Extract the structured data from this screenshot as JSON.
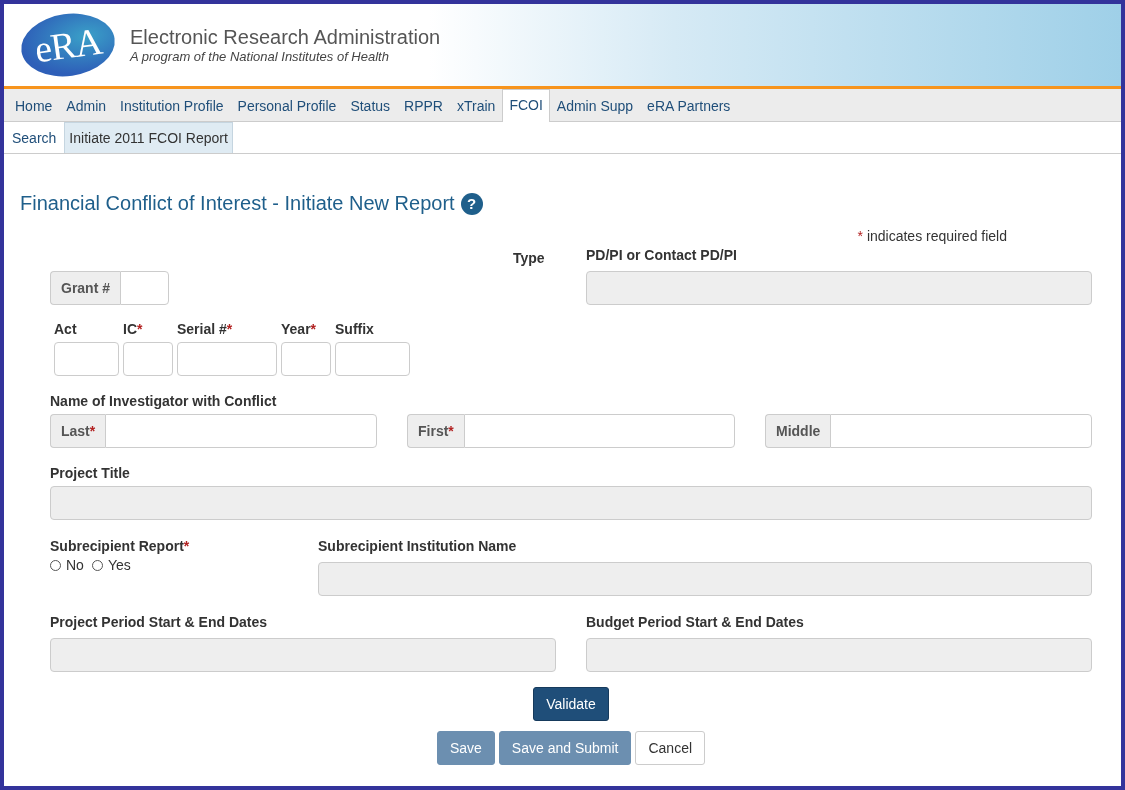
{
  "header": {
    "logo": "eRA",
    "title": "Electronic Research Administration",
    "subtitle": "A program of the National Institutes of Health"
  },
  "nav_tabs": [
    {
      "label": "Home",
      "selected": false
    },
    {
      "label": "Admin",
      "selected": false
    },
    {
      "label": "Institution Profile",
      "selected": false
    },
    {
      "label": "Personal Profile",
      "selected": false
    },
    {
      "label": "Status",
      "selected": false
    },
    {
      "label": "RPPR",
      "selected": false
    },
    {
      "label": "xTrain",
      "selected": false
    },
    {
      "label": "FCOI",
      "selected": true
    },
    {
      "label": "Admin Supp",
      "selected": false
    },
    {
      "label": "eRA Partners",
      "selected": false
    }
  ],
  "sub_tabs": [
    {
      "label": "Search",
      "selected": false
    },
    {
      "label": "Initiate 2011 FCOI Report",
      "selected": true
    }
  ],
  "page_title": "Financial Conflict of Interest - Initiate New Report",
  "help_icon": "?",
  "required_note": {
    "mark": "*",
    "text": "indicates required field"
  },
  "grant": {
    "label": "Grant #",
    "disabled": false
  },
  "type_label": "Type",
  "pd_pi": {
    "label": "PD/PI or Contact PD/PI",
    "disabled": true
  },
  "grant_parts": [
    {
      "label": "Act",
      "disabled": false
    },
    {
      "label": "IC",
      "required_mark": "*",
      "disabled": false
    },
    {
      "label": "Serial #",
      "required_mark": "*",
      "disabled": false
    },
    {
      "label": "Year",
      "required_mark": "*",
      "disabled": false
    },
    {
      "label": "Suffix",
      "disabled": false
    }
  ],
  "investigator": {
    "heading": "Name of Investigator with Conflict",
    "fields": [
      {
        "label": "Last",
        "required_mark": "*",
        "disabled": false
      },
      {
        "label": "First",
        "required_mark": "*",
        "disabled": false
      },
      {
        "label": "Middle",
        "disabled": false
      }
    ]
  },
  "project_title": {
    "label": "Project Title",
    "disabled": true
  },
  "subrecipient": {
    "label": "Subrecipient Report",
    "required_mark": "*",
    "options": [
      {
        "label": "No",
        "selected": false
      },
      {
        "label": "Yes",
        "selected": false
      }
    ]
  },
  "subrecipient_institution": {
    "label": "Subrecipient Institution Name",
    "disabled": true
  },
  "project_period": {
    "label": "Project Period Start & End Dates",
    "disabled": true
  },
  "budget_period": {
    "label": "Budget Period Start & End Dates",
    "disabled": true
  },
  "validate_button": {
    "label": "Validate",
    "kind": "primary",
    "disabled": false
  },
  "buttons": [
    {
      "label": "Save",
      "kind": "primary",
      "disabled": true
    },
    {
      "label": "Save and Submit",
      "kind": "primary",
      "disabled": true
    },
    {
      "label": "Cancel",
      "kind": "default",
      "disabled": false
    }
  ]
}
